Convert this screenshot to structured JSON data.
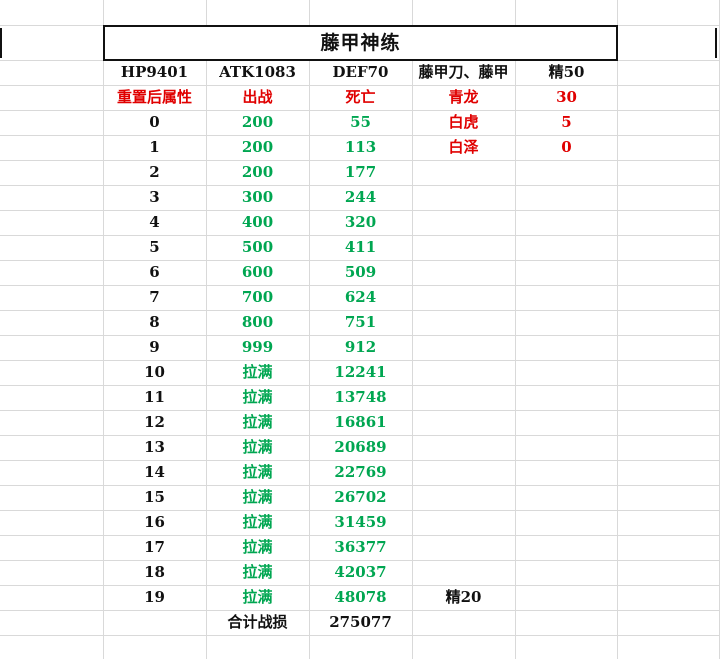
{
  "sheet": {
    "title": "藤甲神练",
    "stats": {
      "hp": "HP9401",
      "atk": "ATK1083",
      "def": "DEF70",
      "equip": "藤甲刀、藤甲",
      "jing": "精50"
    },
    "headers": {
      "level": "重置后属性",
      "battle": "出战",
      "death": "死亡"
    },
    "side": [
      {
        "name": "青龙",
        "value": "30"
      },
      {
        "name": "白虎",
        "value": "5"
      },
      {
        "name": "白泽",
        "value": "0"
      }
    ],
    "rows": [
      {
        "level": "0",
        "battle": "200",
        "death": "55"
      },
      {
        "level": "1",
        "battle": "200",
        "death": "113"
      },
      {
        "level": "2",
        "battle": "200",
        "death": "177"
      },
      {
        "level": "3",
        "battle": "300",
        "death": "244"
      },
      {
        "level": "4",
        "battle": "400",
        "death": "320"
      },
      {
        "level": "5",
        "battle": "500",
        "death": "411"
      },
      {
        "level": "6",
        "battle": "600",
        "death": "509"
      },
      {
        "level": "7",
        "battle": "700",
        "death": "624"
      },
      {
        "level": "8",
        "battle": "800",
        "death": "751"
      },
      {
        "level": "9",
        "battle": "999",
        "death": "912"
      },
      {
        "level": "10",
        "battle": "拉满",
        "death": "12241"
      },
      {
        "level": "11",
        "battle": "拉满",
        "death": "13748"
      },
      {
        "level": "12",
        "battle": "拉满",
        "death": "16861"
      },
      {
        "level": "13",
        "battle": "拉满",
        "death": "20689"
      },
      {
        "level": "14",
        "battle": "拉满",
        "death": "22769"
      },
      {
        "level": "15",
        "battle": "拉满",
        "death": "26702"
      },
      {
        "level": "16",
        "battle": "拉满",
        "death": "31459"
      },
      {
        "level": "17",
        "battle": "拉满",
        "death": "36377"
      },
      {
        "level": "18",
        "battle": "拉满",
        "death": "42037"
      },
      {
        "level": "19",
        "battle": "拉满",
        "death": "48078"
      }
    ],
    "row19_note": "精20",
    "total": {
      "label": "合计战损",
      "value": "275077"
    },
    "colors": {
      "black": "#111111",
      "red": "#e00000",
      "green": "#00a651",
      "grid": "#d9d9d9"
    }
  }
}
